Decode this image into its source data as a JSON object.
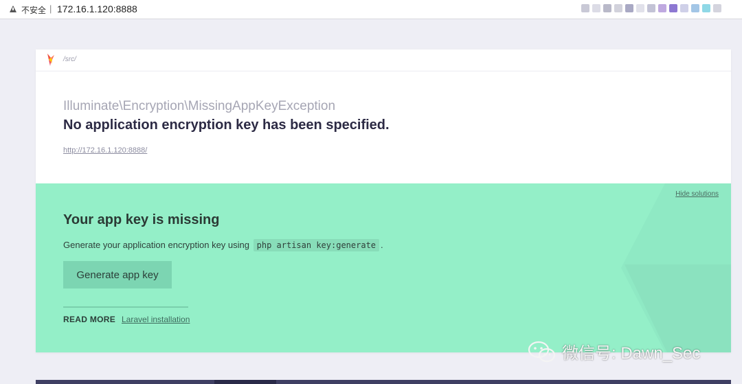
{
  "browser": {
    "insecure_label": "不安全",
    "separator": "|",
    "url": "172.16.1.120:8888",
    "extension_colors": [
      "#c9c9d6",
      "#dcdce6",
      "#b9b9c9",
      "#d2d2dc",
      "#a9a9c4",
      "#e1e1ea",
      "#c3c3d6",
      "#bfa9e0",
      "#8d78d2",
      "#cfd0e8",
      "#a3c6e6",
      "#8fd8e6",
      "#d4d4de"
    ]
  },
  "header": {
    "path": "/src/"
  },
  "exception": {
    "class": "Illuminate\\Encryption\\MissingAppKeyException",
    "message": "No application encryption key has been specified.",
    "url": "http://172.16.1.120:8888/"
  },
  "solution": {
    "hide_label": "Hide solutions",
    "title": "Your app key is missing",
    "description_before": "Generate your application encryption key using",
    "command": "php artisan key:generate",
    "description_after": ".",
    "button_label": "Generate app key",
    "read_more_label": "READ MORE",
    "read_more_link": "Laravel installation"
  },
  "watermark": {
    "text": "微信号: Dawn_Sec"
  },
  "colors": {
    "solution_bg": "#94efc8",
    "page_bg": "#eeeef5"
  }
}
